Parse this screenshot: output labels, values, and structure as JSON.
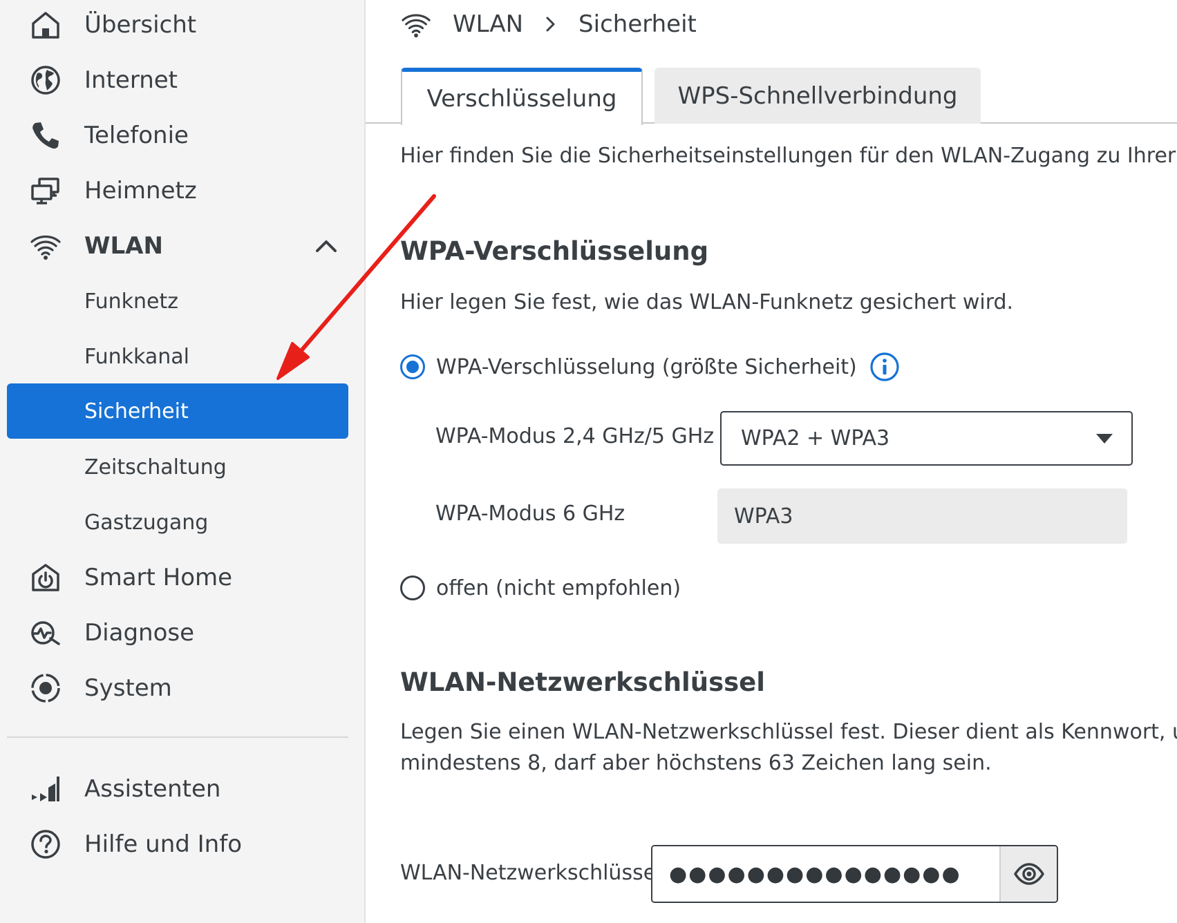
{
  "sidebar": {
    "items": [
      {
        "label": "Übersicht",
        "icon": "home-icon"
      },
      {
        "label": "Internet",
        "icon": "globe-icon"
      },
      {
        "label": "Telefonie",
        "icon": "phone-icon"
      },
      {
        "label": "Heimnetz",
        "icon": "network-icon"
      },
      {
        "label": "WLAN",
        "icon": "wifi-icon",
        "expanded": true
      },
      {
        "label": "Smart Home",
        "icon": "smart-home-icon"
      },
      {
        "label": "Diagnose",
        "icon": "diagnose-icon"
      },
      {
        "label": "System",
        "icon": "system-icon"
      },
      {
        "label": "Assistenten",
        "icon": "assistant-icon"
      },
      {
        "label": "Hilfe und Info",
        "icon": "help-icon"
      }
    ],
    "wlan_subitems": [
      {
        "label": "Funknetz"
      },
      {
        "label": "Funkkanal"
      },
      {
        "label": "Sicherheit",
        "active": true
      },
      {
        "label": "Zeitschaltung"
      },
      {
        "label": "Gastzugang"
      }
    ]
  },
  "breadcrumb": {
    "section": "WLAN",
    "page": "Sicherheit"
  },
  "tabs": [
    {
      "label": "Verschlüsselung",
      "active": true
    },
    {
      "label": "WPS-Schnellverbindung",
      "active": false
    }
  ],
  "content": {
    "intro": "Hier finden Sie die Sicherheitseinstellungen für den WLAN-Zugang zu Ihrer FRITZ!B",
    "wpa_section": {
      "heading": "WPA-Verschlüsselung",
      "description": "Hier legen Sie fest, wie das WLAN-Funknetz gesichert wird.",
      "option_wpa": {
        "label": "WPA-Verschlüsselung (größte Sicherheit)",
        "checked": true
      },
      "mode_24_5": {
        "label": "WPA-Modus 2,4 GHz/5 GHz",
        "value": "WPA2 + WPA3"
      },
      "mode_6": {
        "label": "WPA-Modus 6 GHz",
        "value": "WPA3"
      },
      "option_open": {
        "label": "offen (nicht empfohlen)",
        "checked": false
      }
    },
    "key_section": {
      "heading": "WLAN-Netzwerkschlüssel",
      "description_line1": "Legen Sie einen WLAN-Netzwerkschlüssel fest. Dieser dient als Kennwort, um die V",
      "description_line2": "mindestens 8, darf aber höchstens 63 Zeichen lang sein.",
      "field_label": "WLAN-Netzwerkschlüssel",
      "masked_value": "●●●●●●●●●●●●●●●"
    }
  },
  "colors": {
    "accent": "#1672d6",
    "annotation_arrow": "#e8201a",
    "sidebar_bg": "#f4f4f4",
    "text": "#3a3f44"
  }
}
